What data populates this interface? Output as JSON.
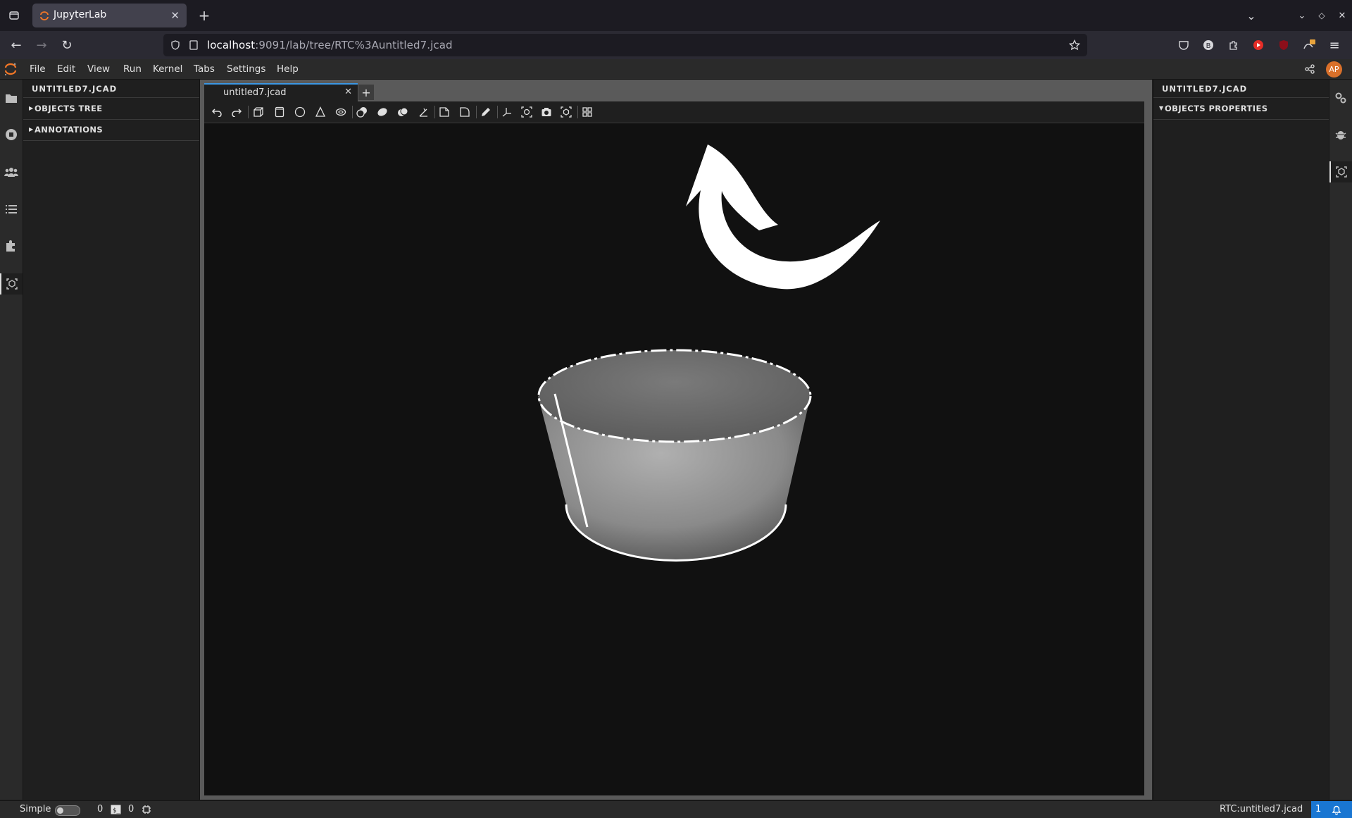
{
  "browser": {
    "tab_title": "JupyterLab",
    "url_host": "localhost",
    "url_rest": ":9091/lab/tree/RTC%3Auntitled7.jcad"
  },
  "menubar": {
    "items": [
      "File",
      "Edit",
      "View",
      "Run",
      "Kernel",
      "Tabs",
      "Settings",
      "Help"
    ],
    "avatar_initials": "AP"
  },
  "left_panel": {
    "title": "UNTITLED7.JCAD",
    "sections": [
      "OBJECTS TREE",
      "ANNOTATIONS"
    ]
  },
  "right_panel": {
    "title": "UNTITLED7.JCAD",
    "sections": [
      "OBJECTS PROPERTIES"
    ]
  },
  "document": {
    "tab_title": "untitled7.jcad",
    "add_tab_label": "+"
  },
  "toolbar": {
    "icons": [
      "undo-icon",
      "redo-icon",
      "box-icon",
      "cylinder-icon",
      "sphere-icon",
      "cone-icon",
      "torus-icon",
      "cut-icon",
      "extrude-icon",
      "union-icon",
      "intersection-icon",
      "chamfer-icon",
      "fillet-icon",
      "sketch-icon",
      "axes-icon",
      "explode-icon",
      "camera-icon",
      "wireframe-icon",
      "grid-icon"
    ]
  },
  "statusbar": {
    "mode_label": "Simple",
    "terminals_count": "0",
    "kernels_count": "0",
    "document_label": "RTC:untitled7.jcad",
    "notification_count": "1"
  },
  "colors": {
    "accent": "#1976d2",
    "tab_highlight": "#3b97e3",
    "avatar": "#d9702a",
    "viewport_bg": "#111111"
  }
}
